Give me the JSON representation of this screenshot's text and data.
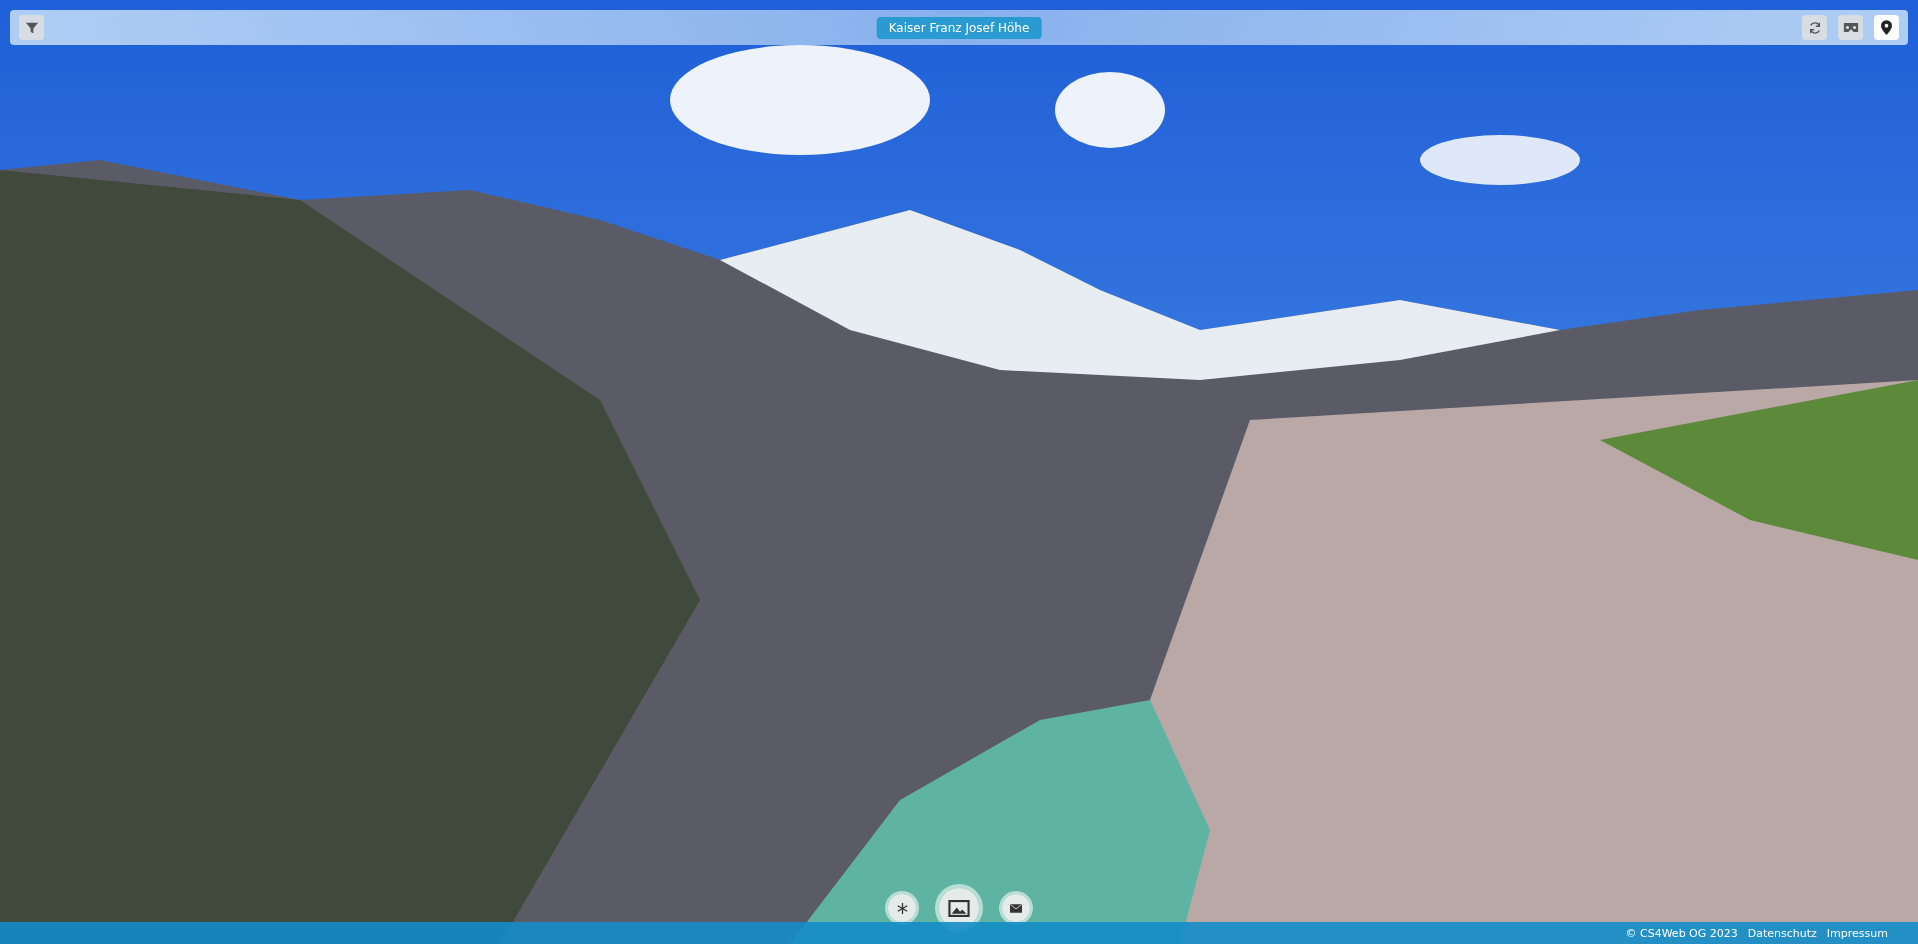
{
  "top_bar": {
    "title": "Kaiser Franz Josef Höhe",
    "tool_buttons": [
      {
        "selected": false
      },
      {
        "selected": false
      },
      {
        "selected": true
      }
    ]
  },
  "scene_buttons": [
    {
      "selected": false
    },
    {
      "selected": true
    },
    {
      "selected": false
    }
  ],
  "footer": {
    "copyright": "© CS4Web OG 2023",
    "links": [
      "Datenschutz",
      "Impressum"
    ]
  }
}
